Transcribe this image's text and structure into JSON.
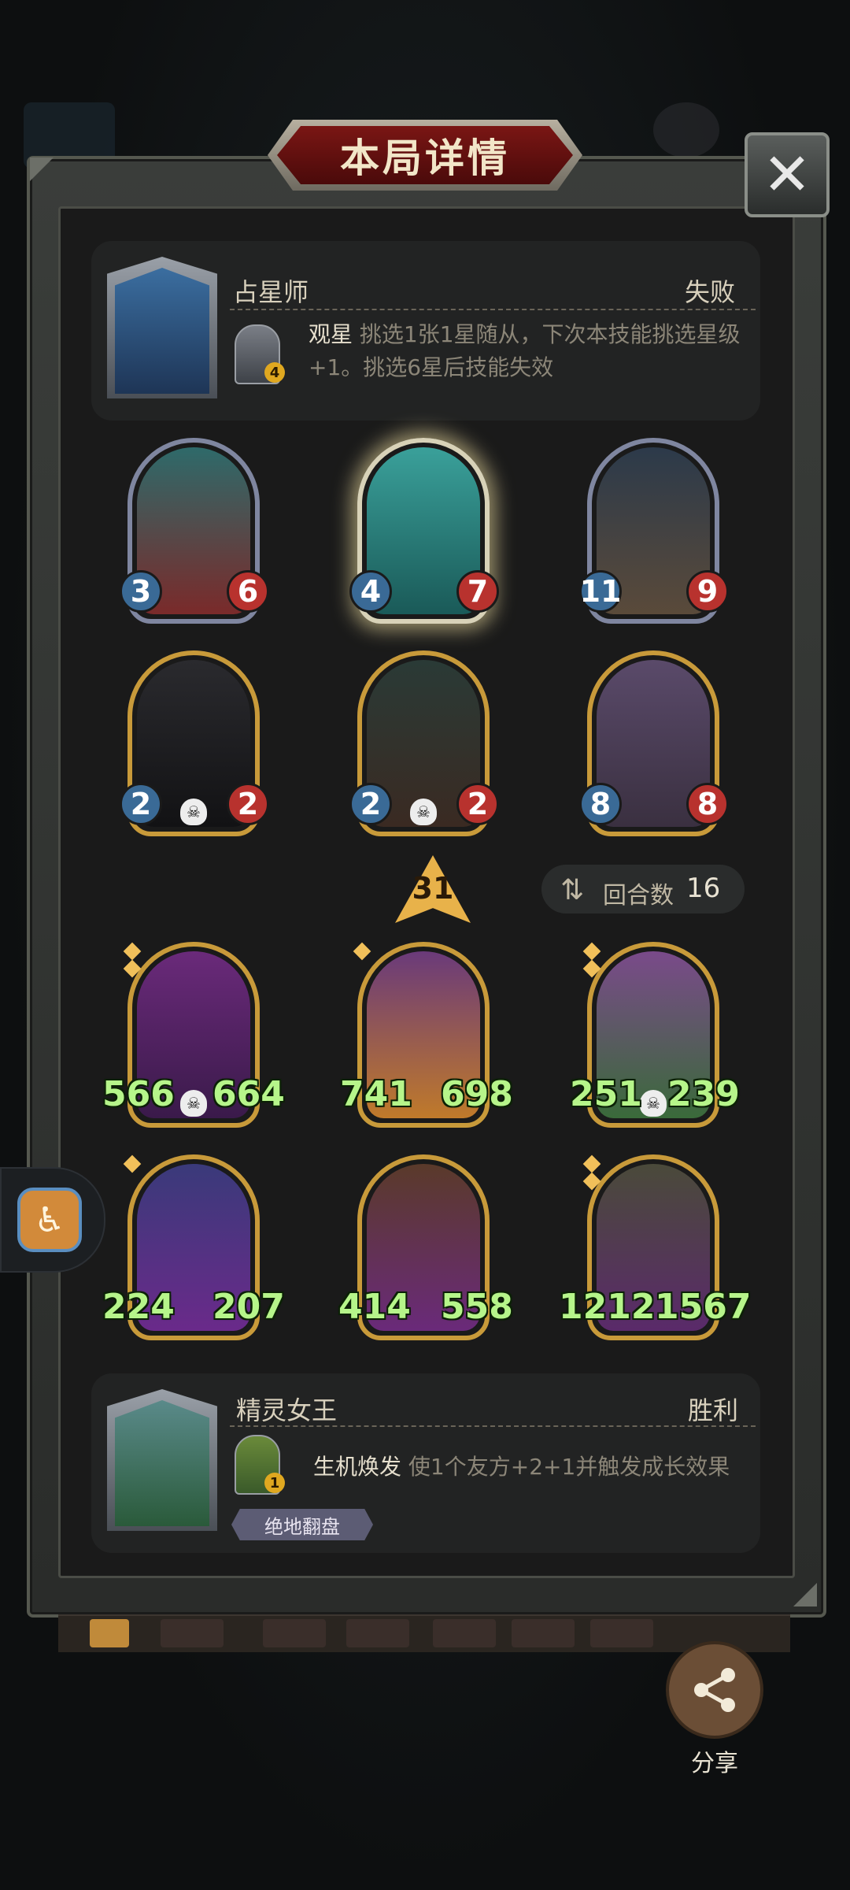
{
  "header": {
    "title": "本局详情",
    "close_label": "✕"
  },
  "top_player": {
    "name": "占星师",
    "result": "失败",
    "skill": {
      "level": "4",
      "name": "观星",
      "desc": "挑选1张1星随从，下次本技能挑选星级+1。挑选6星后技能失效"
    }
  },
  "top_board": [
    {
      "atk": "3",
      "hp": "6"
    },
    {
      "atk": "4",
      "hp": "7"
    },
    {
      "atk": "11",
      "hp": "9"
    },
    {
      "atk": "2",
      "hp": "2"
    },
    {
      "atk": "2",
      "hp": "2"
    },
    {
      "atk": "8",
      "hp": "8"
    }
  ],
  "round_info": {
    "damage": "31",
    "label": "回合数",
    "count": "16"
  },
  "bottom_board": [
    {
      "atk": "566",
      "hp": "664"
    },
    {
      "atk": "741",
      "hp": "698"
    },
    {
      "atk": "251",
      "hp": "239"
    },
    {
      "atk": "224",
      "hp": "207"
    },
    {
      "atk": "414",
      "hp": "558"
    },
    {
      "atk": "1212",
      "hp": "1567"
    }
  ],
  "bottom_player": {
    "name": "精灵女王",
    "result": "胜利",
    "skill": {
      "level": "1",
      "name": "生机焕发",
      "desc": "使1个友方+2+1并触发成长效果"
    },
    "tag": "绝地翻盘"
  },
  "share": {
    "label": "分享"
  },
  "icons": [
    "close-icon",
    "share-icon",
    "round-icon",
    "skull-icon",
    "accessibility-icon"
  ]
}
